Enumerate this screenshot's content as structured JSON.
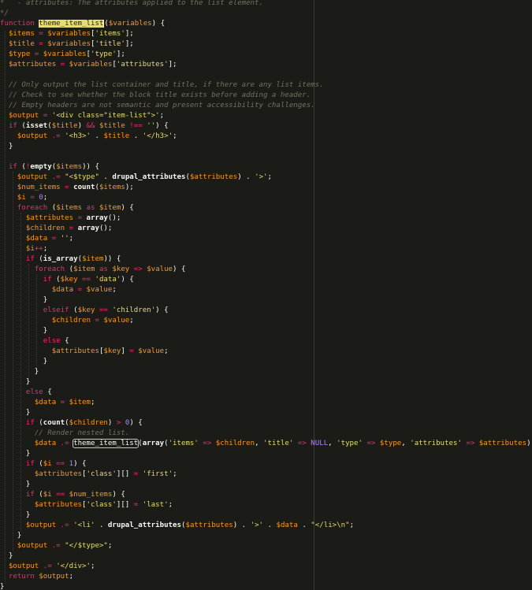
{
  "editor": {
    "language": "php",
    "theme_colors": {
      "background": "#1b1c18",
      "keyword": "#f92672",
      "variable": "#fd971f",
      "string": "#e6db74",
      "comment": "#75715e",
      "number": "#ae81ff",
      "function_name": "#a6e22e",
      "selection": "#e6db74"
    },
    "lines": [
      [
        [
          "cm",
          "*   - attributes: The attributes applied to the list element."
        ]
      ],
      [
        [
          "cm",
          "*/"
        ]
      ],
      [
        [
          "kw",
          "function "
        ],
        [
          "sel",
          "theme_item_list"
        ],
        [
          "pl",
          "("
        ],
        [
          "var",
          "$variables"
        ],
        [
          "pl",
          ") {"
        ]
      ],
      [
        [
          "pl",
          "  "
        ],
        [
          "var",
          "$items"
        ],
        [
          "op",
          " = "
        ],
        [
          "var",
          "$variables"
        ],
        [
          "pl",
          "["
        ],
        [
          "str",
          "'items'"
        ],
        [
          "pl",
          "];"
        ]
      ],
      [
        [
          "pl",
          "  "
        ],
        [
          "var",
          "$title"
        ],
        [
          "op",
          " = "
        ],
        [
          "var",
          "$variables"
        ],
        [
          "pl",
          "["
        ],
        [
          "str",
          "'title'"
        ],
        [
          "pl",
          "];"
        ]
      ],
      [
        [
          "pl",
          "  "
        ],
        [
          "var",
          "$type"
        ],
        [
          "op",
          " = "
        ],
        [
          "var",
          "$variables"
        ],
        [
          "pl",
          "["
        ],
        [
          "str",
          "'type'"
        ],
        [
          "pl",
          "];"
        ]
      ],
      [
        [
          "pl",
          "  "
        ],
        [
          "var",
          "$attributes"
        ],
        [
          "op",
          " = "
        ],
        [
          "var",
          "$variables"
        ],
        [
          "pl",
          "["
        ],
        [
          "str",
          "'attributes'"
        ],
        [
          "pl",
          "];"
        ]
      ],
      [
        [
          "pl",
          ""
        ]
      ],
      [
        [
          "pl",
          "  "
        ],
        [
          "cm",
          "// Only output the list container and title, if there are any list items."
        ]
      ],
      [
        [
          "pl",
          "  "
        ],
        [
          "cm",
          "// Check to see whether the block title exists before adding a header."
        ]
      ],
      [
        [
          "pl",
          "  "
        ],
        [
          "cm",
          "// Empty headers are not semantic and present accessibility challenges."
        ]
      ],
      [
        [
          "pl",
          "  "
        ],
        [
          "var",
          "$output"
        ],
        [
          "op",
          " = "
        ],
        [
          "str",
          "'<div class=\"item-list\">'"
        ],
        [
          "pl",
          ";"
        ]
      ],
      [
        [
          "pl",
          "  "
        ],
        [
          "kw",
          "if"
        ],
        [
          "pl",
          " ("
        ],
        [
          "call",
          "isset"
        ],
        [
          "pl",
          "("
        ],
        [
          "var",
          "$title"
        ],
        [
          "pl",
          ") "
        ],
        [
          "op",
          "&&"
        ],
        [
          "pl",
          " "
        ],
        [
          "var",
          "$title"
        ],
        [
          "op",
          " !== "
        ],
        [
          "str",
          "''"
        ],
        [
          "pl",
          ") {"
        ]
      ],
      [
        [
          "pl",
          "    "
        ],
        [
          "var",
          "$output"
        ],
        [
          "op",
          " .= "
        ],
        [
          "str",
          "'<h3>'"
        ],
        [
          "pl",
          " . "
        ],
        [
          "var",
          "$title"
        ],
        [
          "pl",
          " . "
        ],
        [
          "str",
          "'</h3>'"
        ],
        [
          "pl",
          ";"
        ]
      ],
      [
        [
          "pl",
          "  }"
        ]
      ],
      [
        [
          "pl",
          ""
        ]
      ],
      [
        [
          "pl",
          "  "
        ],
        [
          "kw",
          "if"
        ],
        [
          "pl",
          " ("
        ],
        [
          "op",
          "!"
        ],
        [
          "call",
          "empty"
        ],
        [
          "pl",
          "("
        ],
        [
          "var",
          "$items"
        ],
        [
          "pl",
          ")) {"
        ]
      ],
      [
        [
          "pl",
          "    "
        ],
        [
          "var",
          "$output"
        ],
        [
          "op",
          " .= "
        ],
        [
          "str",
          "\"<$type\""
        ],
        [
          "pl",
          " . "
        ],
        [
          "call",
          "drupal_attributes"
        ],
        [
          "pl",
          "("
        ],
        [
          "var",
          "$attributes"
        ],
        [
          "pl",
          ") . "
        ],
        [
          "str",
          "'>'"
        ],
        [
          "pl",
          ";"
        ]
      ],
      [
        [
          "pl",
          "    "
        ],
        [
          "var",
          "$num_items"
        ],
        [
          "op",
          " = "
        ],
        [
          "call",
          "count"
        ],
        [
          "pl",
          "("
        ],
        [
          "var",
          "$items"
        ],
        [
          "pl",
          ");"
        ]
      ],
      [
        [
          "pl",
          "    "
        ],
        [
          "var",
          "$i"
        ],
        [
          "op",
          " = "
        ],
        [
          "num",
          "0"
        ],
        [
          "pl",
          ";"
        ]
      ],
      [
        [
          "pl",
          "    "
        ],
        [
          "kw",
          "foreach"
        ],
        [
          "pl",
          " ("
        ],
        [
          "var",
          "$items"
        ],
        [
          "kw",
          " as "
        ],
        [
          "var",
          "$item"
        ],
        [
          "pl",
          ") {"
        ]
      ],
      [
        [
          "pl",
          "      "
        ],
        [
          "var",
          "$attributes"
        ],
        [
          "op",
          " = "
        ],
        [
          "call",
          "array"
        ],
        [
          "pl",
          "();"
        ]
      ],
      [
        [
          "pl",
          "      "
        ],
        [
          "var",
          "$children"
        ],
        [
          "op",
          " = "
        ],
        [
          "call",
          "array"
        ],
        [
          "pl",
          "();"
        ]
      ],
      [
        [
          "pl",
          "      "
        ],
        [
          "var",
          "$data"
        ],
        [
          "op",
          " = "
        ],
        [
          "str",
          "''"
        ],
        [
          "pl",
          ";"
        ]
      ],
      [
        [
          "pl",
          "      "
        ],
        [
          "var",
          "$i"
        ],
        [
          "op",
          "++"
        ],
        [
          "pl",
          ";"
        ]
      ],
      [
        [
          "pl",
          "      "
        ],
        [
          "kw",
          "if"
        ],
        [
          "pl",
          " ("
        ],
        [
          "call",
          "is_array"
        ],
        [
          "pl",
          "("
        ],
        [
          "var",
          "$item"
        ],
        [
          "pl",
          ")) {"
        ]
      ],
      [
        [
          "pl",
          "        "
        ],
        [
          "kw",
          "foreach"
        ],
        [
          "pl",
          " ("
        ],
        [
          "var",
          "$item"
        ],
        [
          "kw",
          " as "
        ],
        [
          "var",
          "$key"
        ],
        [
          "op",
          " => "
        ],
        [
          "var",
          "$value"
        ],
        [
          "pl",
          ") {"
        ]
      ],
      [
        [
          "pl",
          "          "
        ],
        [
          "kw",
          "if"
        ],
        [
          "pl",
          " ("
        ],
        [
          "var",
          "$key"
        ],
        [
          "op",
          " == "
        ],
        [
          "str",
          "'data'"
        ],
        [
          "pl",
          ") {"
        ]
      ],
      [
        [
          "pl",
          "            "
        ],
        [
          "var",
          "$data"
        ],
        [
          "op",
          " = "
        ],
        [
          "var",
          "$value"
        ],
        [
          "pl",
          ";"
        ]
      ],
      [
        [
          "pl",
          "          }"
        ]
      ],
      [
        [
          "pl",
          "          "
        ],
        [
          "kw",
          "elseif"
        ],
        [
          "pl",
          " ("
        ],
        [
          "var",
          "$key"
        ],
        [
          "op",
          " == "
        ],
        [
          "str",
          "'children'"
        ],
        [
          "pl",
          ") {"
        ]
      ],
      [
        [
          "pl",
          "            "
        ],
        [
          "var",
          "$children"
        ],
        [
          "op",
          " = "
        ],
        [
          "var",
          "$value"
        ],
        [
          "pl",
          ";"
        ]
      ],
      [
        [
          "pl",
          "          }"
        ]
      ],
      [
        [
          "pl",
          "          "
        ],
        [
          "kw",
          "else"
        ],
        [
          "pl",
          " {"
        ]
      ],
      [
        [
          "pl",
          "            "
        ],
        [
          "var",
          "$attributes"
        ],
        [
          "pl",
          "["
        ],
        [
          "var",
          "$key"
        ],
        [
          "pl",
          "]"
        ],
        [
          "op",
          " = "
        ],
        [
          "var",
          "$value"
        ],
        [
          "pl",
          ";"
        ]
      ],
      [
        [
          "pl",
          "          }"
        ]
      ],
      [
        [
          "pl",
          "        }"
        ]
      ],
      [
        [
          "pl",
          "      }"
        ]
      ],
      [
        [
          "pl",
          "      "
        ],
        [
          "kw",
          "else"
        ],
        [
          "pl",
          " {"
        ]
      ],
      [
        [
          "pl",
          "        "
        ],
        [
          "var",
          "$data"
        ],
        [
          "op",
          " = "
        ],
        [
          "var",
          "$item"
        ],
        [
          "pl",
          ";"
        ]
      ],
      [
        [
          "pl",
          "      }"
        ]
      ],
      [
        [
          "pl",
          "      "
        ],
        [
          "kw",
          "if"
        ],
        [
          "pl",
          " ("
        ],
        [
          "call",
          "count"
        ],
        [
          "pl",
          "("
        ],
        [
          "var",
          "$children"
        ],
        [
          "pl",
          ") "
        ],
        [
          "op",
          ">"
        ],
        [
          "pl",
          " "
        ],
        [
          "num",
          "0"
        ],
        [
          "pl",
          ") {"
        ]
      ],
      [
        [
          "pl",
          "        "
        ],
        [
          "cm",
          "// Render nested list."
        ]
      ],
      [
        [
          "pl",
          "        "
        ],
        [
          "var",
          "$data"
        ],
        [
          "op",
          " .= "
        ],
        [
          "box",
          "theme_item_list"
        ],
        [
          "pl",
          "("
        ],
        [
          "call",
          "array"
        ],
        [
          "pl",
          "("
        ],
        [
          "str",
          "'items'"
        ],
        [
          "op",
          " => "
        ],
        [
          "var",
          "$children"
        ],
        [
          "pl",
          ", "
        ],
        [
          "str",
          "'title'"
        ],
        [
          "op",
          " => "
        ],
        [
          "const",
          "NULL"
        ],
        [
          "pl",
          ", "
        ],
        [
          "str",
          "'type'"
        ],
        [
          "op",
          " => "
        ],
        [
          "var",
          "$type"
        ],
        [
          "pl",
          ", "
        ],
        [
          "str",
          "'attributes'"
        ],
        [
          "op",
          " => "
        ],
        [
          "var",
          "$attributes"
        ],
        [
          "pl",
          "));"
        ]
      ],
      [
        [
          "pl",
          "      }"
        ]
      ],
      [
        [
          "pl",
          "      "
        ],
        [
          "kw",
          "if"
        ],
        [
          "pl",
          " ("
        ],
        [
          "var",
          "$i"
        ],
        [
          "op",
          " == "
        ],
        [
          "num",
          "1"
        ],
        [
          "pl",
          ") {"
        ]
      ],
      [
        [
          "pl",
          "        "
        ],
        [
          "var",
          "$attributes"
        ],
        [
          "pl",
          "["
        ],
        [
          "str",
          "'class'"
        ],
        [
          "pl",
          "][]"
        ],
        [
          "op",
          " = "
        ],
        [
          "str",
          "'first'"
        ],
        [
          "pl",
          ";"
        ]
      ],
      [
        [
          "pl",
          "      }"
        ]
      ],
      [
        [
          "pl",
          "      "
        ],
        [
          "kw",
          "if"
        ],
        [
          "pl",
          " ("
        ],
        [
          "var",
          "$i"
        ],
        [
          "op",
          " == "
        ],
        [
          "var",
          "$num_items"
        ],
        [
          "pl",
          ") {"
        ]
      ],
      [
        [
          "pl",
          "        "
        ],
        [
          "var",
          "$attributes"
        ],
        [
          "pl",
          "["
        ],
        [
          "str",
          "'class'"
        ],
        [
          "pl",
          "][]"
        ],
        [
          "op",
          " = "
        ],
        [
          "str",
          "'last'"
        ],
        [
          "pl",
          ";"
        ]
      ],
      [
        [
          "pl",
          "      }"
        ]
      ],
      [
        [
          "pl",
          "      "
        ],
        [
          "var",
          "$output"
        ],
        [
          "op",
          " .= "
        ],
        [
          "str",
          "'<li'"
        ],
        [
          "pl",
          " . "
        ],
        [
          "call",
          "drupal_attributes"
        ],
        [
          "pl",
          "("
        ],
        [
          "var",
          "$attributes"
        ],
        [
          "pl",
          ") . "
        ],
        [
          "str",
          "'>'"
        ],
        [
          "pl",
          " . "
        ],
        [
          "var",
          "$data"
        ],
        [
          "pl",
          " . "
        ],
        [
          "str",
          "\"</li>\\n\""
        ],
        [
          "pl",
          ";"
        ]
      ],
      [
        [
          "pl",
          "    }"
        ]
      ],
      [
        [
          "pl",
          "    "
        ],
        [
          "var",
          "$output"
        ],
        [
          "op",
          " .= "
        ],
        [
          "str",
          "\"</$type>\""
        ],
        [
          "pl",
          ";"
        ]
      ],
      [
        [
          "pl",
          "  }"
        ]
      ],
      [
        [
          "pl",
          "  "
        ],
        [
          "var",
          "$output"
        ],
        [
          "op",
          " .= "
        ],
        [
          "str",
          "'</div>'"
        ],
        [
          "pl",
          ";"
        ]
      ],
      [
        [
          "pl",
          "  "
        ],
        [
          "kw",
          "return"
        ],
        [
          "pl",
          " "
        ],
        [
          "var",
          "$output"
        ],
        [
          "pl",
          ";"
        ]
      ],
      [
        [
          "pl",
          "}"
        ]
      ]
    ]
  }
}
